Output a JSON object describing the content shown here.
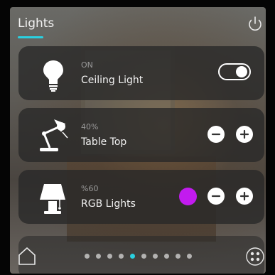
{
  "header": {
    "title": "Lights"
  },
  "icons": {
    "power": "power-icon",
    "home": "home-icon",
    "grid": "grid-menu-icon"
  },
  "colors": {
    "accent": "#2ad0e0",
    "rgb_light": "#c21bef"
  },
  "devices": [
    {
      "state": "ON",
      "name": "Ceiling Light",
      "icon": "bulb-icon",
      "control": "toggle",
      "toggle_on": true
    },
    {
      "state": "40%",
      "name": "Table Top",
      "icon": "desk-lamp-icon",
      "control": "stepper"
    },
    {
      "state": "%60",
      "name": "RGB Lights",
      "icon": "table-lamp-icon",
      "control": "color-stepper"
    }
  ],
  "pager": {
    "count": 10,
    "active_index": 4
  }
}
